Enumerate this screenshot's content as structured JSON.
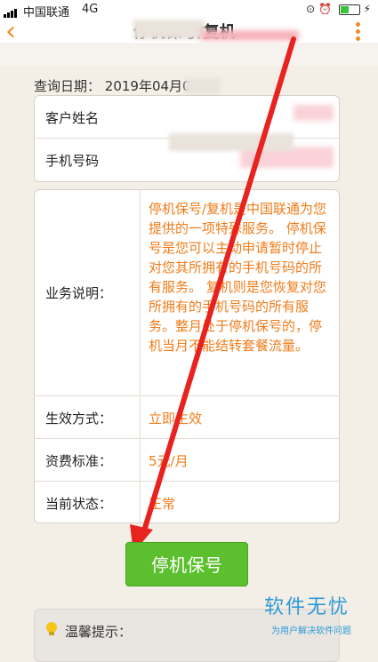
{
  "status": {
    "carrier": "中国联通",
    "network": "4G"
  },
  "nav": {
    "title": "停机保号/复机"
  },
  "query": {
    "label": "查询日期：",
    "date": "2019年04月0"
  },
  "customer": [
    {
      "label": "客户姓名",
      "value": ""
    },
    {
      "label": "手机号码",
      "value": ""
    }
  ],
  "service": {
    "desc_label": "业务说明：",
    "desc_text": "停机保号/复机是中国联通为您提供的一项特殊服务。 停机保号是您可以主动申请暂时停止对您其所拥有的手机号码的所有服务。 复机则是您恢复对您所拥有的手机号码的所有服务。整月处于停机保号的，停机当月不能结转套餐流量。",
    "effect_label": "生效方式：",
    "effect_value": "立即生效",
    "fee_label": "资费标准：",
    "fee_value": "5元/月",
    "state_label": "当前状态：",
    "state_value": "正常"
  },
  "action": {
    "button": "停机保号"
  },
  "tips": {
    "title": "温馨提示："
  },
  "watermark": {
    "main": "软件无忧",
    "sub": "为用户解决软件问题"
  },
  "colors": {
    "accent": "#f08a24",
    "value_text": "#f07c1a",
    "button": "#5bbf2e",
    "arrow": "#e8231f",
    "background": "#f3eee6"
  }
}
